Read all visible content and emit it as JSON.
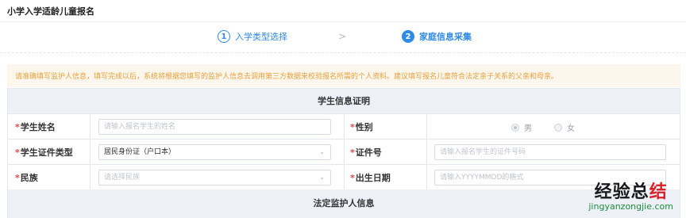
{
  "page": {
    "title": "小学入学适龄儿童报名"
  },
  "steps": [
    {
      "num": "1",
      "label": "入学类型选择"
    },
    {
      "num": "2",
      "label": "家庭信息采集"
    }
  ],
  "steps_separator": ">",
  "notice": "请准确填写监护人信息，填写完成以后，系统将根据您填写的监护人信息去调用第三方数据来校验报名所需的个人资料。建议填写报名儿童符合法定亲子关系的父亲和母亲。",
  "student_section": {
    "title": "学生信息证明",
    "name_label": "学生姓名",
    "name_placeholder": "请输入报名学生的姓名",
    "gender_label": "性别",
    "gender_options": [
      "男",
      "女"
    ],
    "gender_selected": "男",
    "id_type_label": "学生证件类型",
    "id_type_value": "居民身份证（户口本）",
    "id_number_label": "证件号",
    "id_number_placeholder": "请输入报名学生的证件号码",
    "ethnicity_label": "民族",
    "ethnicity_placeholder": "请选择民族",
    "birthdate_label": "出生日期",
    "birthdate_placeholder": "请输入YYYYMMDD的格式",
    "required_mark": "*"
  },
  "guardian_section": {
    "title": "法定监护人信息"
  },
  "icons": {
    "caret": "caret-down-icon"
  },
  "colors": {
    "accent": "#2f8ae5",
    "notice_text": "#e6a23c",
    "notice_bg": "#fdf6ec",
    "required": "#e64242"
  },
  "watermark": {
    "brand": "经验总结",
    "brand_red": "结",
    "url": "jingyanzongjie.com"
  }
}
